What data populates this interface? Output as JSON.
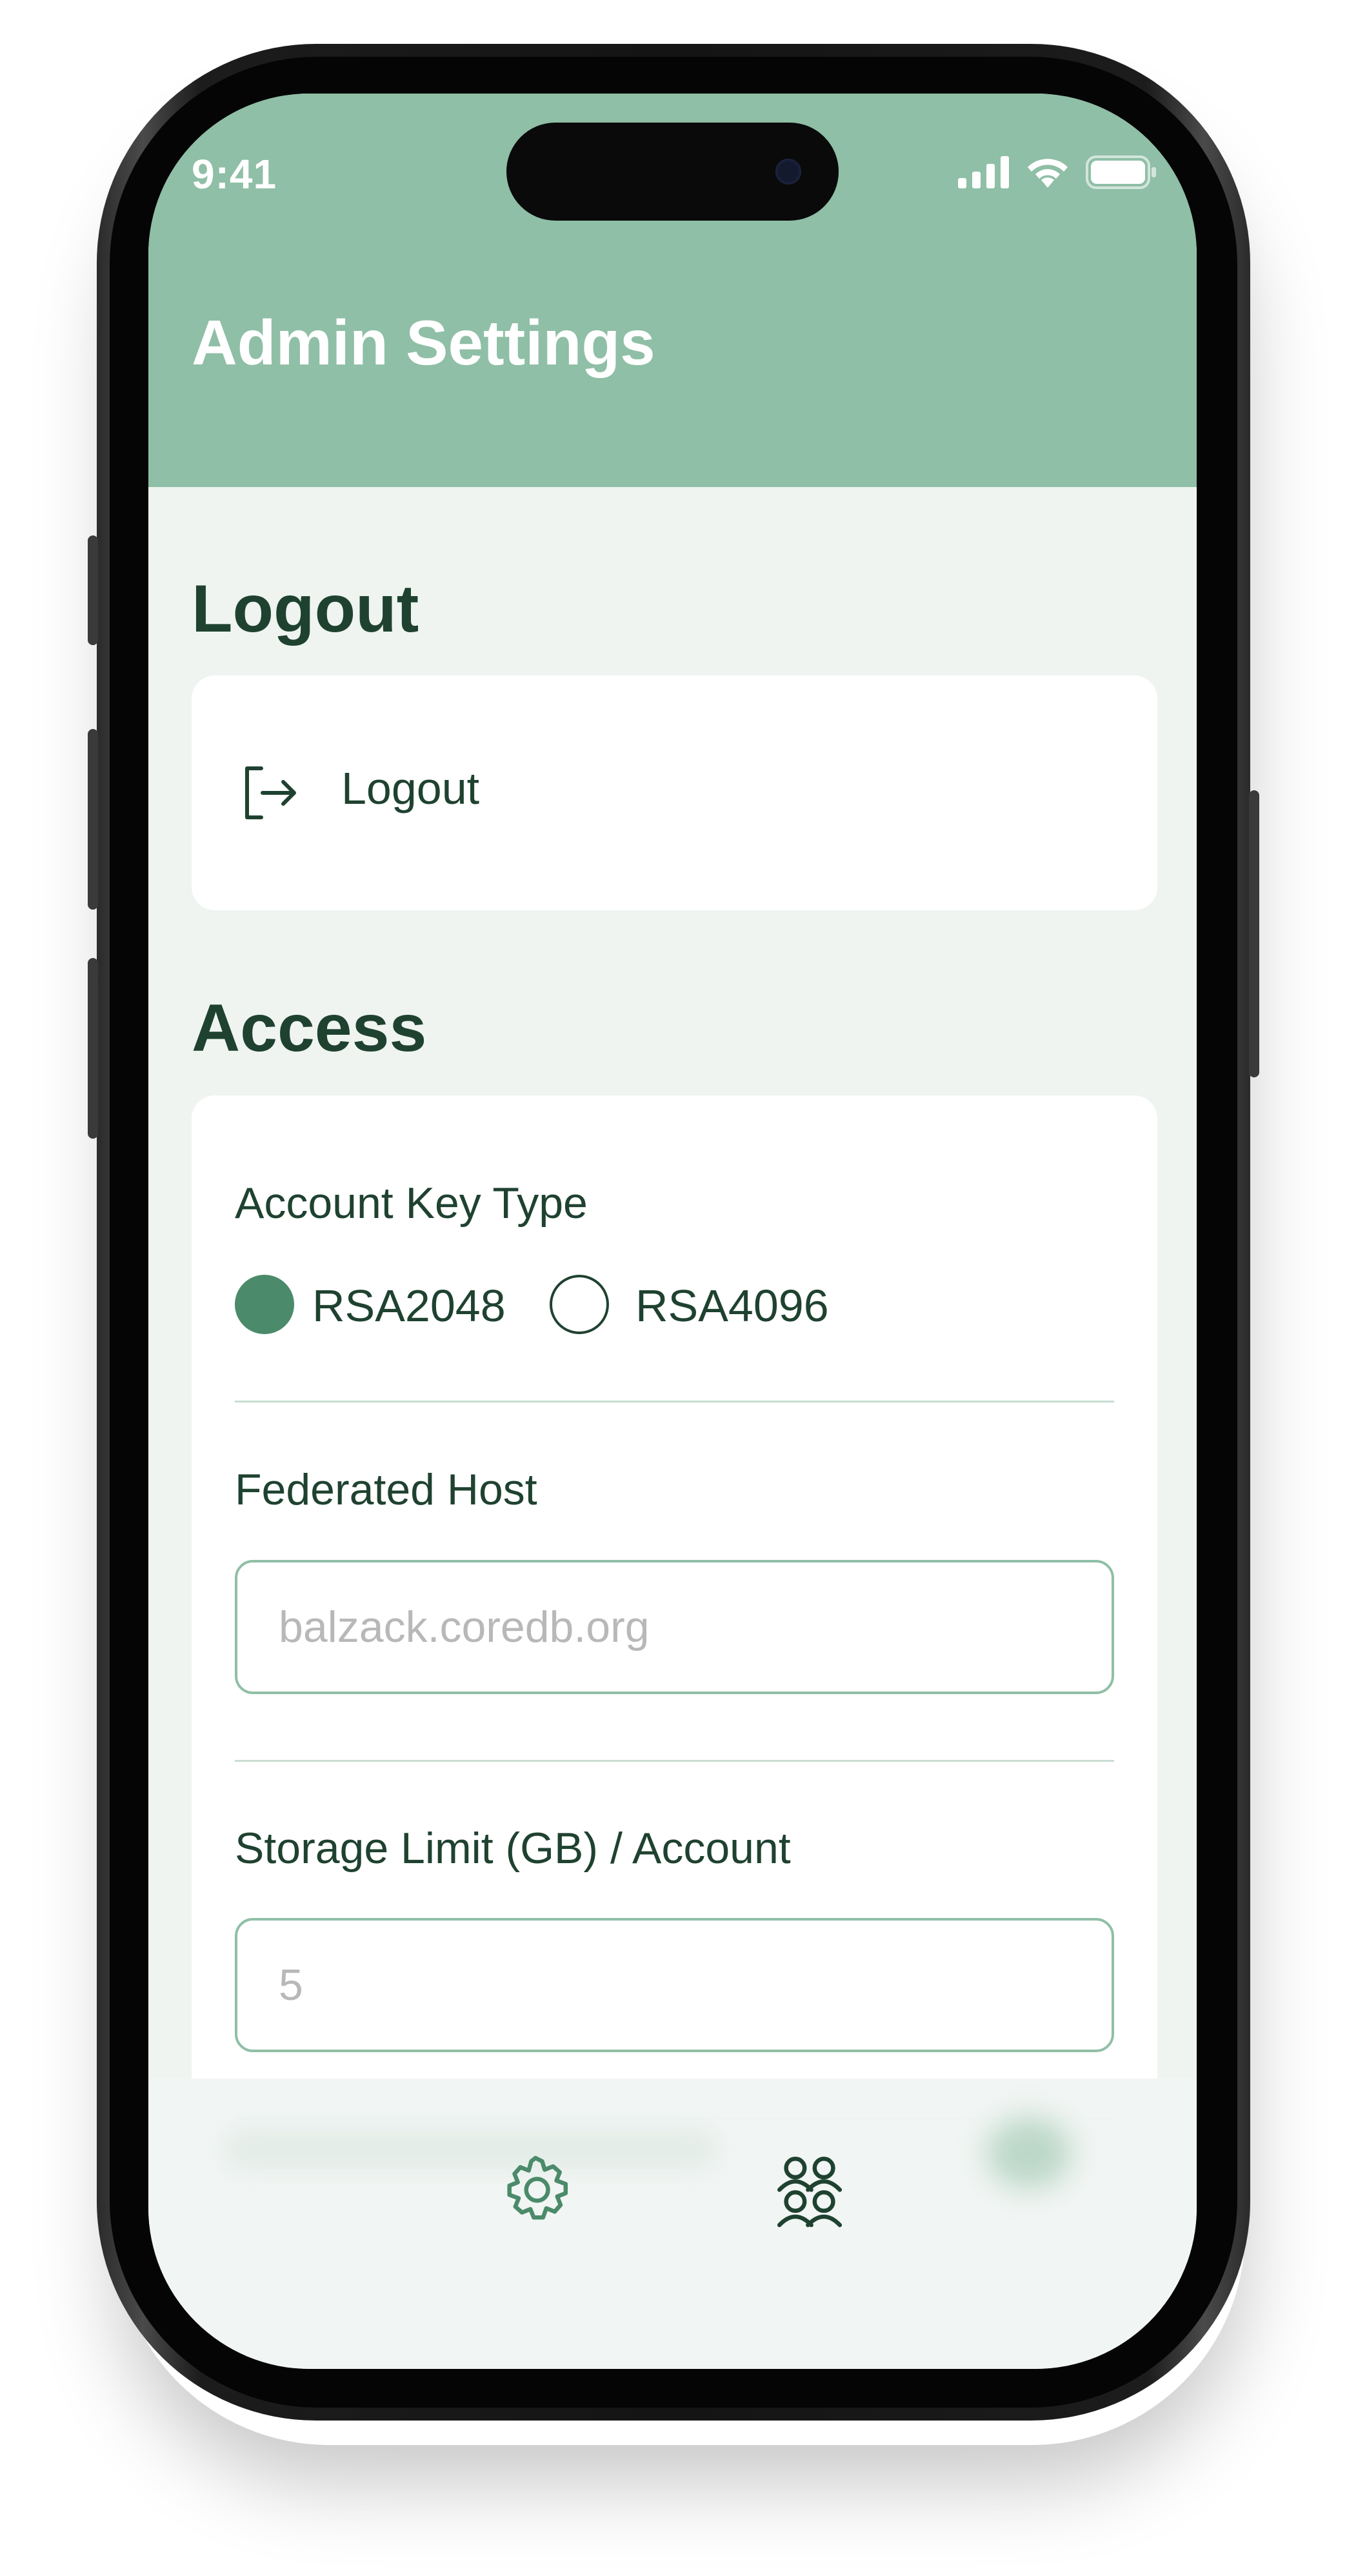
{
  "status_bar": {
    "time": "9:41"
  },
  "header": {
    "title": "Admin Settings"
  },
  "sections": {
    "logout": {
      "title": "Logout",
      "item_label": "Logout"
    },
    "access": {
      "title": "Access",
      "account_key_type": {
        "label": "Account Key Type",
        "options": [
          "RSA2048",
          "RSA4096"
        ],
        "selected": "RSA2048"
      },
      "federated_host": {
        "label": "Federated Host",
        "placeholder": "balzack.coredb.org",
        "value": ""
      },
      "storage_limit": {
        "label": "Storage Limit (GB) / Account",
        "placeholder": "5",
        "value": ""
      }
    }
  },
  "tab_bar": {
    "tabs": [
      {
        "icon": "gear-icon",
        "active": false
      },
      {
        "icon": "users-icon",
        "active": true
      }
    ]
  },
  "colors": {
    "header_bg": "#8fbfa6",
    "page_bg": "#eff4f1",
    "primary_text": "#1f4230",
    "accent": "#4b8a6a",
    "input_border": "#8fbfa6"
  }
}
